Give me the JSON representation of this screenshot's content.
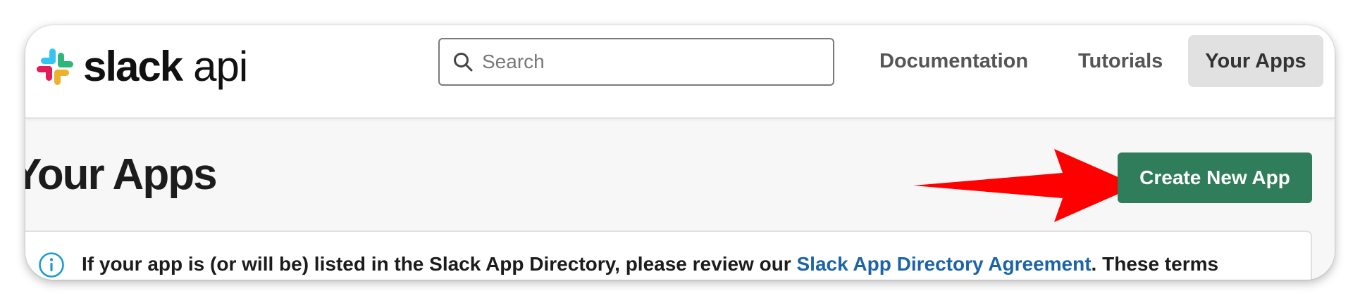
{
  "header": {
    "logo_word": "slack",
    "logo_suffix": "api",
    "search_placeholder": "Search",
    "search_value": "",
    "nav": {
      "documentation": "Documentation",
      "tutorials": "Tutorials",
      "your_apps": "Your Apps"
    }
  },
  "main": {
    "title": "Your Apps",
    "create_button": "Create New App"
  },
  "notice": {
    "text_before": "If your app is (or will be) listed in the Slack App Directory, please review our ",
    "link_text": "Slack App Directory Agreement",
    "text_after": ". These terms"
  },
  "colors": {
    "create_button_bg": "#2f7d5a",
    "link": "#1d64a6",
    "annotation_arrow": "#ff0000",
    "logo_blue": "#36c5f0",
    "logo_green": "#2eb67d",
    "logo_yellow": "#ecb22e",
    "logo_red": "#e01e5a"
  },
  "icons": [
    "slack-logo-icon",
    "search-icon",
    "info-icon",
    "annotation-arrow-icon"
  ]
}
